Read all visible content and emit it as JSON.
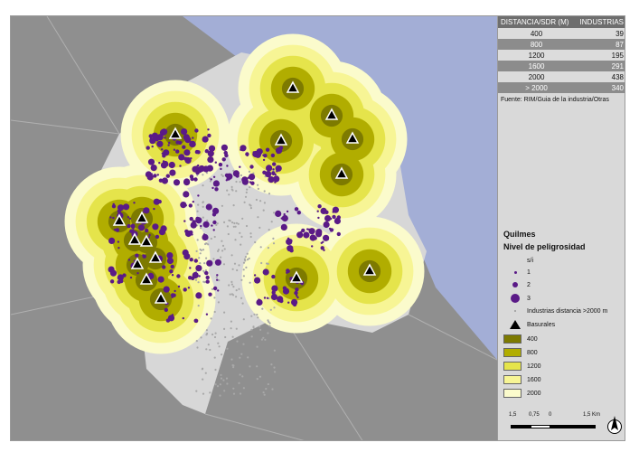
{
  "map": {
    "title": "Quilmes",
    "legend_subtitle": "Nivel de peligrosidad",
    "source": "Fuente: RIM/Guia de la industria/Otras",
    "colors": {
      "water": "#a3aed6",
      "land_outer": "#8f8f8f",
      "land_quilmes": "#d7d7d7",
      "boundary": "#b0b0b0",
      "industry_dot": "#5a1a87",
      "far_industry": "#a8a8a8",
      "buffer_400": "#7d7a00",
      "buffer_800": "#b1ad00",
      "buffer_1200": "#e5e44b",
      "buffer_1600": "#f7f595",
      "buffer_2000": "#fbfbcc",
      "dump_marker": "#000000"
    }
  },
  "distance_table": {
    "header": [
      "DISTANCIA/SDR (M)",
      "INDUSTRIAS"
    ],
    "rows": [
      [
        "400",
        "39"
      ],
      [
        "800",
        "87"
      ],
      [
        "1200",
        "195"
      ],
      [
        "1600",
        "291"
      ],
      [
        "2000",
        "438"
      ],
      [
        "> 2000",
        "340"
      ]
    ]
  },
  "legend": {
    "danger_levels": [
      "s/i",
      "1",
      "2",
      "3"
    ],
    "far_industries_label": "Industrias distancia  >2000 m",
    "dumps_label": "Basurales",
    "buffers": [
      "400",
      "800",
      "1200",
      "1600",
      "2000"
    ]
  },
  "scalebar": {
    "labels": [
      "1,5",
      "0,75",
      "0",
      "1,5 Km"
    ]
  },
  "icons": {
    "north_arrow": "north-arrow-icon",
    "dump": "triangle-icon"
  }
}
